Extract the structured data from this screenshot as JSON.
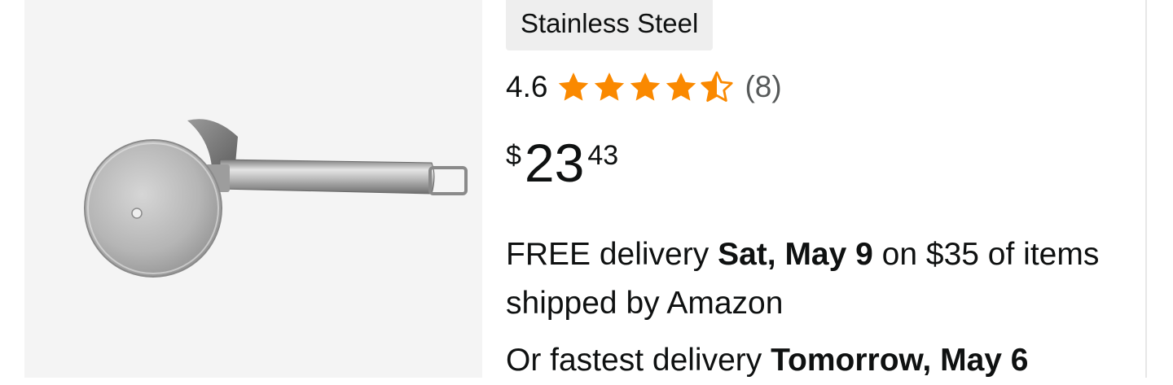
{
  "product": {
    "image_alt": "Stainless steel pizza cutter wheel",
    "variant_chip": "Stainless Steel",
    "rating": {
      "value_text": "4.6",
      "value": 4.6,
      "max": 5,
      "count_text": "(8)",
      "star_color": "#fa8900"
    },
    "price": {
      "symbol": "$",
      "whole": "23",
      "fraction": "43"
    },
    "delivery": {
      "prefix": "FREE delivery ",
      "date": "Sat, May 9",
      "suffix": " on $35 of items shipped by Amazon"
    },
    "fastest": {
      "prefix": "Or fastest delivery ",
      "date": "Tomorrow, May 6"
    }
  }
}
